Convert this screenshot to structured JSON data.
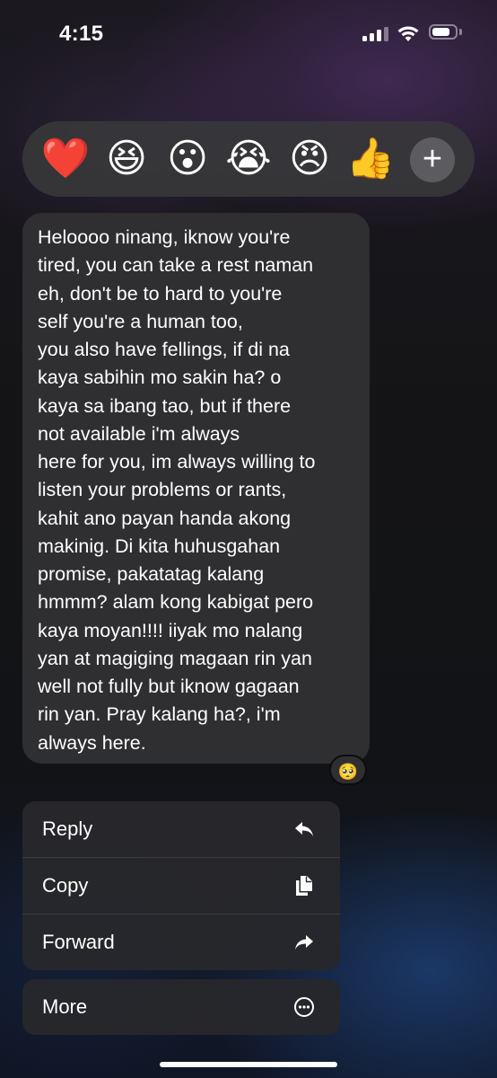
{
  "status_bar": {
    "time": "4:15",
    "battery_level": 0.83
  },
  "reactions": [
    "❤️",
    "😆",
    "😮",
    "😭",
    "😠",
    "👍"
  ],
  "reaction_more_label": "+",
  "message": {
    "lines": [
      "Heloooo ninang, iknow you're",
      "tired, you can take a rest naman",
      "eh, don't be to hard to you're",
      "self you're a human too,",
      "you also have fellings, if di na",
      "kaya sabihin mo sakin ha? o",
      "kaya sa ibang tao, but if there",
      "not available i'm always",
      "here for you, im always willing to",
      "listen your problems or rants,",
      "kahit ano payan handa akong",
      "makinig. Di kita huhusgahan",
      "promise, pakatatag kalang",
      "hmmm? alam kong kabigat pero",
      "kaya moyan!!!! iiyak mo nalang",
      "yan at magiging magaan rin yan",
      "well not fully but iknow gagaan",
      "rin yan. Pray kalang ha?, i'm",
      "always here."
    ],
    "reaction": "🥺",
    "bubble_color": "#2f2f31"
  },
  "menu": {
    "items": [
      {
        "label": "Reply",
        "icon": "reply-icon"
      },
      {
        "label": "Copy",
        "icon": "copy-icon"
      },
      {
        "label": "Forward",
        "icon": "forward-icon"
      }
    ],
    "more": {
      "label": "More",
      "icon": "more-icon"
    }
  }
}
